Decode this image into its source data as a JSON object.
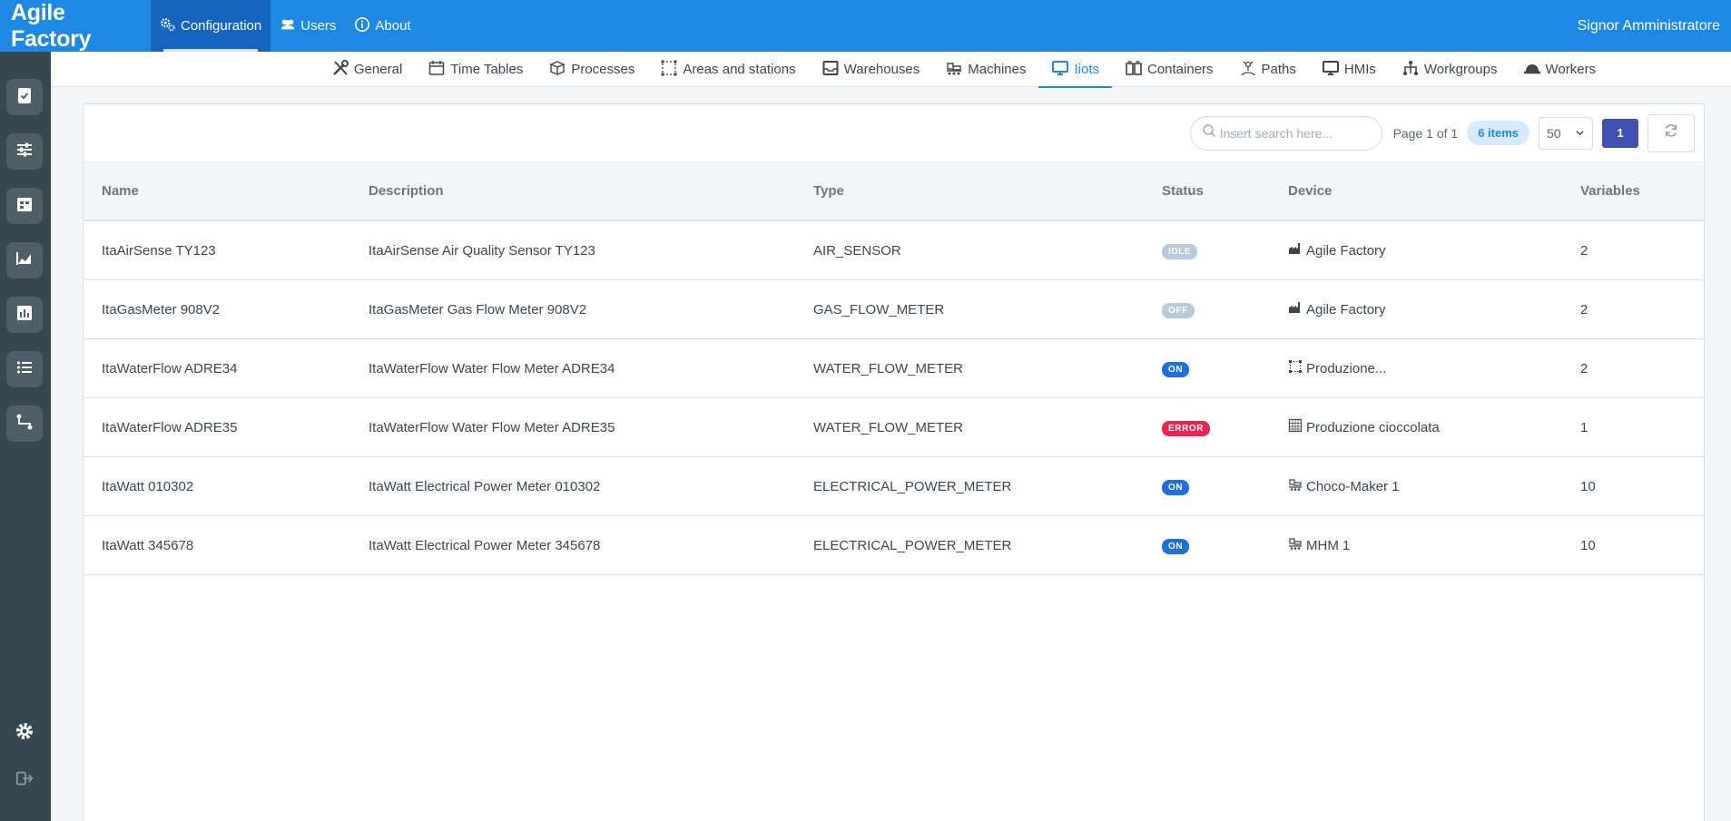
{
  "app": {
    "title": "Agile Factory",
    "user": "Signor Amministratore"
  },
  "topnav": [
    {
      "label": "Configuration",
      "icon": "gears-icon",
      "active": true
    },
    {
      "label": "Users",
      "icon": "users-icon",
      "active": false
    },
    {
      "label": "About",
      "icon": "info-icon",
      "active": false
    }
  ],
  "sidebar": {
    "items": [
      "clipboard-check-icon",
      "sliders-icon",
      "calendar-icon",
      "area-chart-icon",
      "bar-chart-icon",
      "list-icon",
      "route-icon"
    ],
    "bottom": [
      "settings-gear-icon",
      "logout-icon"
    ]
  },
  "subnav": [
    {
      "label": "General",
      "icon": "tools-icon"
    },
    {
      "label": "Time Tables",
      "icon": "calendar-icon"
    },
    {
      "label": "Processes",
      "icon": "processes-icon"
    },
    {
      "label": "Areas and stations",
      "icon": "area-icon"
    },
    {
      "label": "Warehouses",
      "icon": "warehouse-icon"
    },
    {
      "label": "Machines",
      "icon": "machine-icon"
    },
    {
      "label": "Iiots",
      "icon": "monitor-icon",
      "active": true
    },
    {
      "label": "Containers",
      "icon": "containers-icon"
    },
    {
      "label": "Paths",
      "icon": "paths-icon"
    },
    {
      "label": "HMIs",
      "icon": "hmi-icon"
    },
    {
      "label": "Workgroups",
      "icon": "workgroups-icon"
    },
    {
      "label": "Workers",
      "icon": "helmet-icon"
    }
  ],
  "toolbar": {
    "search_placeholder": "Insert search here...",
    "page_info": "Page 1 of 1",
    "items_count": "6 items",
    "per_page": "50",
    "current_page": "1"
  },
  "table": {
    "columns": [
      "Name",
      "Description",
      "Type",
      "Status",
      "Device",
      "Variables"
    ],
    "status_colors": {
      "IDLE": "#b8c9d9",
      "OFF": "#b8c9d9",
      "ON": "#1e6fe0",
      "ERROR": "#e8244f"
    },
    "rows": [
      {
        "name": "ItaAirSense TY123",
        "description": "ItaAirSense Air Quality Sensor TY123",
        "type": "AIR_SENSOR",
        "status": "IDLE",
        "device_icon": "factory-icon",
        "device": "Agile Factory",
        "variables": "2"
      },
      {
        "name": "ItaGasMeter 908V2",
        "description": "ItaGasMeter Gas Flow Meter 908V2",
        "type": "GAS_FLOW_METER",
        "status": "OFF",
        "device_icon": "factory-icon",
        "device": "Agile Factory",
        "variables": "2"
      },
      {
        "name": "ItaWaterFlow ADRE34",
        "description": "ItaWaterFlow Water Flow Meter ADRE34",
        "type": "WATER_FLOW_METER",
        "status": "ON",
        "device_icon": "area-icon",
        "device": "Produzione...",
        "variables": "2"
      },
      {
        "name": "ItaWaterFlow ADRE35",
        "description": "ItaWaterFlow Water Flow Meter ADRE35",
        "type": "WATER_FLOW_METER",
        "status": "ERROR",
        "device_icon": "grid-icon",
        "device": "Produzione cioccolata",
        "variables": "1"
      },
      {
        "name": "ItaWatt 010302",
        "description": "ItaWatt Electrical Power Meter 010302",
        "type": "ELECTRICAL_POWER_METER",
        "status": "ON",
        "device_icon": "machine-icon",
        "device": "Choco-Maker 1",
        "variables": "10"
      },
      {
        "name": "ItaWatt 345678",
        "description": "ItaWatt Electrical Power Meter 345678",
        "type": "ELECTRICAL_POWER_METER",
        "status": "ON",
        "device_icon": "machine-icon",
        "device": "MHM 1",
        "variables": "10"
      }
    ]
  }
}
